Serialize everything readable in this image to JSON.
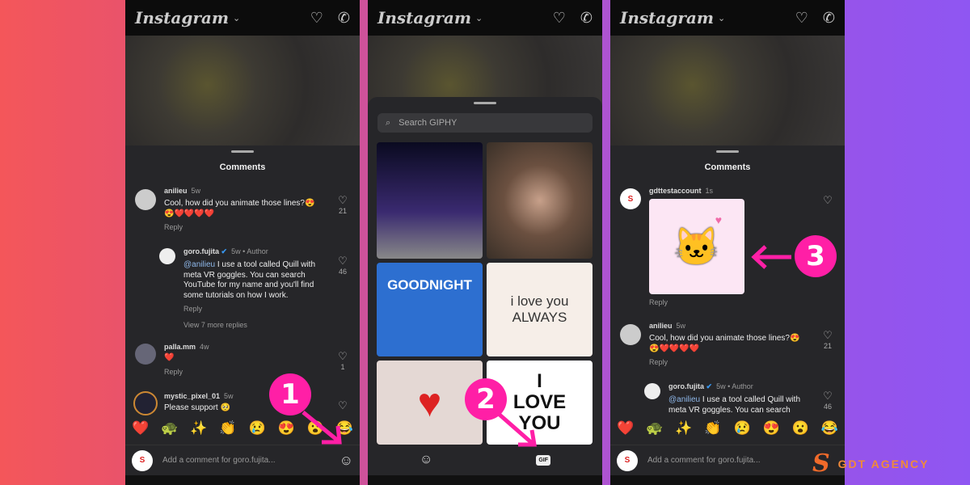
{
  "app": {
    "title": "Instagram"
  },
  "comments_title": "Comments",
  "panel1": {
    "comments": [
      {
        "user": "anilieu",
        "time": "5w",
        "text": "Cool, how did you animate those lines?😍",
        "text2": "😍❤️❤️❤️❤️",
        "reply": "Reply",
        "likes": "21"
      },
      {
        "user": "goro.fujita",
        "time": "5w • Author",
        "mention": "@anilieu",
        "text": " I use a tool called Quill with meta VR goggles. You can search YouTube for my name and you'll find some tutorials on how I work.",
        "reply": "Reply",
        "likes": "46",
        "view_more": "View 7 more replies"
      },
      {
        "user": "palla.mm",
        "time": "4w",
        "text": "❤️",
        "reply": "Reply",
        "likes": "1"
      },
      {
        "user": "mystic_pixel_01",
        "time": "5w",
        "text": "Please support 🥺"
      }
    ],
    "step": "1"
  },
  "panel2": {
    "search_placeholder": "Search GIPHY",
    "gif_texts": [
      "GOODNIGHT",
      "i love you",
      "ALWAYS",
      "I",
      "LOVE",
      "YOU"
    ],
    "gif_tab": "GIF",
    "step": "2"
  },
  "panel3": {
    "comments": [
      {
        "user": "gdttestaccount",
        "time": "1s",
        "reply": "Reply"
      },
      {
        "user": "anilieu",
        "time": "5w",
        "text": "Cool, how did you animate those lines?😍",
        "text2": "😍❤️❤️❤️❤️",
        "reply": "Reply",
        "likes": "21"
      },
      {
        "user": "goro.fujita",
        "time": "5w • Author",
        "mention": "@anilieu",
        "text": " I use a tool called Quill with meta VR goggles. You can search",
        "likes": "46"
      }
    ],
    "step": "3"
  },
  "emoji_bar": [
    "❤️",
    "🐢",
    "✨",
    "👏",
    "😢",
    "😍",
    "😮",
    "😂"
  ],
  "comment_placeholder": "Add a comment for goro.fujita...",
  "brand": "GDT AGENCY",
  "colors": {
    "accent": "#ff1fa6",
    "sheet": "#262629",
    "mention": "#8fb8ea"
  }
}
